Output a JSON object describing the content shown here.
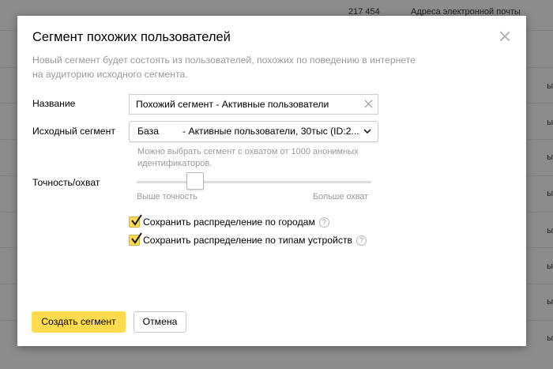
{
  "background": {
    "header_count": "217 454",
    "header_label": "Адреса электронной почты",
    "right_fragment": "ы"
  },
  "modal": {
    "title": "Сегмент похожих пользователей",
    "description": "Новый сегмент будет состоять из пользователей, похожих по поведению в интернете на аудиторию исходного сегмента.",
    "name_label": "Название",
    "name_value": "Похожий сегмент - Активные пользователи",
    "source_label": "Исходный сегмент",
    "source_selected_part1": "База",
    "source_selected_part2": "- Активные пользователи, 30тыс (ID:2...",
    "source_hint": "Можно выбрать сегмент с охватом от 1000 анонимных идентификаторов.",
    "accuracy_label": "Точность/охват",
    "slider_left_caption": "Выше точность",
    "slider_right_caption": "Больше охват",
    "slider_level": 0.25,
    "checkbox_cities_label": "Сохранить распределение по городам",
    "checkbox_cities_checked": true,
    "checkbox_devices_label": "Сохранить распределение по типам устройств",
    "checkbox_devices_checked": true,
    "help_symbol": "?",
    "create_button": "Создать сегмент",
    "cancel_button": "Отмена"
  },
  "colors": {
    "accent_yellow": "#ffdb4d",
    "overlay": "#8c8c8c",
    "muted_text": "#999999"
  }
}
